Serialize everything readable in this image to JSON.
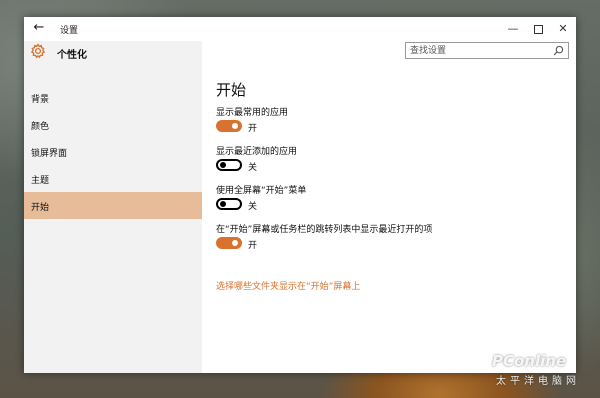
{
  "window": {
    "title": "设置",
    "back_glyph": "←",
    "minimize_glyph": "—",
    "close_glyph": "✕"
  },
  "header": {
    "section_title": "个性化",
    "search_placeholder": "查找设置"
  },
  "sidebar": {
    "items": [
      {
        "label": "背景",
        "selected": false
      },
      {
        "label": "颜色",
        "selected": false
      },
      {
        "label": "锁屏界面",
        "selected": false
      },
      {
        "label": "主题",
        "selected": false
      },
      {
        "label": "开始",
        "selected": true
      }
    ]
  },
  "main": {
    "title": "开始",
    "settings": [
      {
        "label": "显示最常用的应用",
        "state": "开",
        "on": true
      },
      {
        "label": "显示最近添加的应用",
        "state": "关",
        "on": false
      },
      {
        "label": "使用全屏幕“开始”菜单",
        "state": "关",
        "on": false
      },
      {
        "label": "在“开始”屏幕或任务栏的跳转列表中显示最近打开的项",
        "state": "开",
        "on": true
      }
    ],
    "link": "选择哪些文件夹显示在“开始”屏幕上"
  },
  "watermark": {
    "logo": "PConline",
    "sub": "太平洋电脑网"
  },
  "colors": {
    "accent": "#d9722e",
    "selected_nav": "#e6bc99",
    "sidebar_bg": "#f2f2f2"
  },
  "icons": {
    "header": "gear-icon",
    "search": "search-icon",
    "back": "back-arrow-icon",
    "minimize": "minimize-icon",
    "maximize": "maximize-icon",
    "close": "close-icon"
  }
}
